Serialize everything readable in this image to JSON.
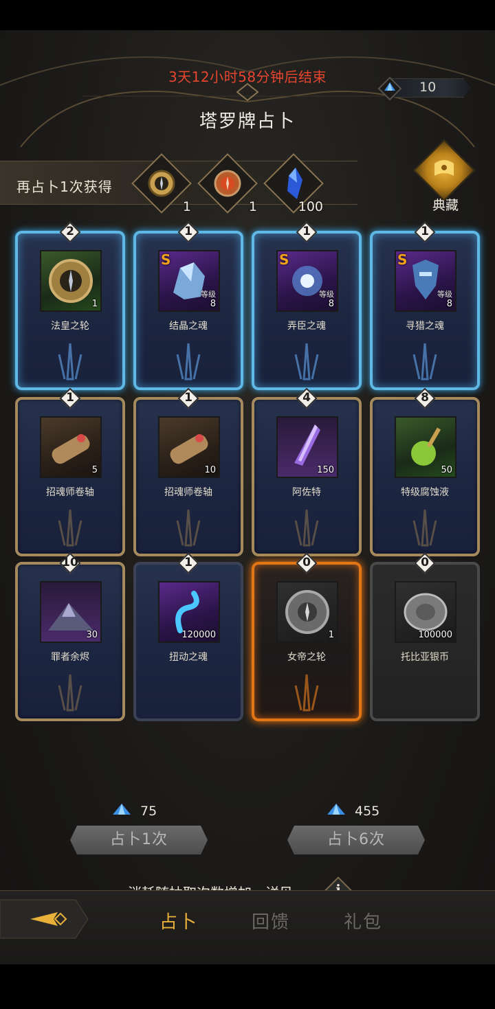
{
  "header": {
    "countdown": "3天12小时58分钟后结束",
    "title": "塔罗牌占卜",
    "currency_icon": "blue-crystal-icon",
    "currency_value": "10"
  },
  "bonus": {
    "label": "再占卜1次获得",
    "rewards": [
      {
        "icon": "gold-compass-medal-icon",
        "qty": "1"
      },
      {
        "icon": "red-compass-medal-icon",
        "qty": "1"
      },
      {
        "icon": "blue-crystal-shard-icon",
        "qty": "100"
      }
    ]
  },
  "codex": {
    "label": "典藏",
    "icon": "golden-scroll-icon"
  },
  "cards": [
    {
      "count": "2",
      "name": "法皇之轮",
      "qty": "1",
      "level_label": "",
      "s_mark": "",
      "frame": "blue",
      "icon": "gold-wheel-icon"
    },
    {
      "count": "1",
      "name": "结晶之魂",
      "qty": "8",
      "level_label": "等级",
      "s_mark": "S",
      "frame": "blue",
      "icon": "crystal-soul-icon"
    },
    {
      "count": "1",
      "name": "弄臣之魂",
      "qty": "8",
      "level_label": "等级",
      "s_mark": "S",
      "frame": "blue",
      "icon": "jester-soul-icon"
    },
    {
      "count": "1",
      "name": "寻猎之魂",
      "qty": "8",
      "level_label": "等级",
      "s_mark": "S",
      "frame": "blue",
      "icon": "hunter-soul-icon"
    },
    {
      "count": "1",
      "name": "招魂师卷轴",
      "qty": "5",
      "level_label": "",
      "s_mark": "",
      "frame": "gold",
      "icon": "scroll-icon"
    },
    {
      "count": "1",
      "name": "招魂师卷轴",
      "qty": "10",
      "level_label": "",
      "s_mark": "",
      "frame": "gold",
      "icon": "scroll-icon"
    },
    {
      "count": "4",
      "name": "阿佐特",
      "qty": "150",
      "level_label": "",
      "s_mark": "",
      "frame": "gold",
      "icon": "purple-crystal-vial-icon"
    },
    {
      "count": "8",
      "name": "特级腐蚀液",
      "qty": "50",
      "level_label": "",
      "s_mark": "",
      "frame": "gold",
      "icon": "green-potion-icon"
    },
    {
      "count": "10",
      "name": "罪者余烬",
      "qty": "30",
      "level_label": "",
      "s_mark": "",
      "frame": "gold",
      "icon": "ember-pile-icon"
    },
    {
      "count": "1",
      "name": "扭动之魂",
      "qty": "120000",
      "level_label": "",
      "s_mark": "",
      "frame": "plain",
      "icon": "blue-wisp-icon"
    },
    {
      "count": "0",
      "name": "女帝之轮",
      "qty": "1",
      "level_label": "",
      "s_mark": "",
      "frame": "fire",
      "icon": "silver-wheel-icon"
    },
    {
      "count": "0",
      "name": "托比亚银币",
      "qty": "100000",
      "level_label": "",
      "s_mark": "",
      "frame": "gray",
      "icon": "silver-coin-icon"
    }
  ],
  "draw": {
    "one": {
      "cost": "75",
      "label": "占卜1次"
    },
    "six": {
      "cost": "455",
      "label": "占卜6次"
    },
    "hint": "消耗随抽取次数增加，详见",
    "info": "i"
  },
  "nav": {
    "back_icon": "back-arrow-icon",
    "tabs": [
      {
        "label": "占卜",
        "active": true
      },
      {
        "label": "回馈",
        "active": false
      },
      {
        "label": "礼包",
        "active": false
      }
    ]
  },
  "colors": {
    "countdown": "#e8452f",
    "active_tab": "#e9b03a",
    "blue_frame": "#5fb8e6",
    "gold_frame": "#a48a5c",
    "fire_frame": "#e07616"
  }
}
